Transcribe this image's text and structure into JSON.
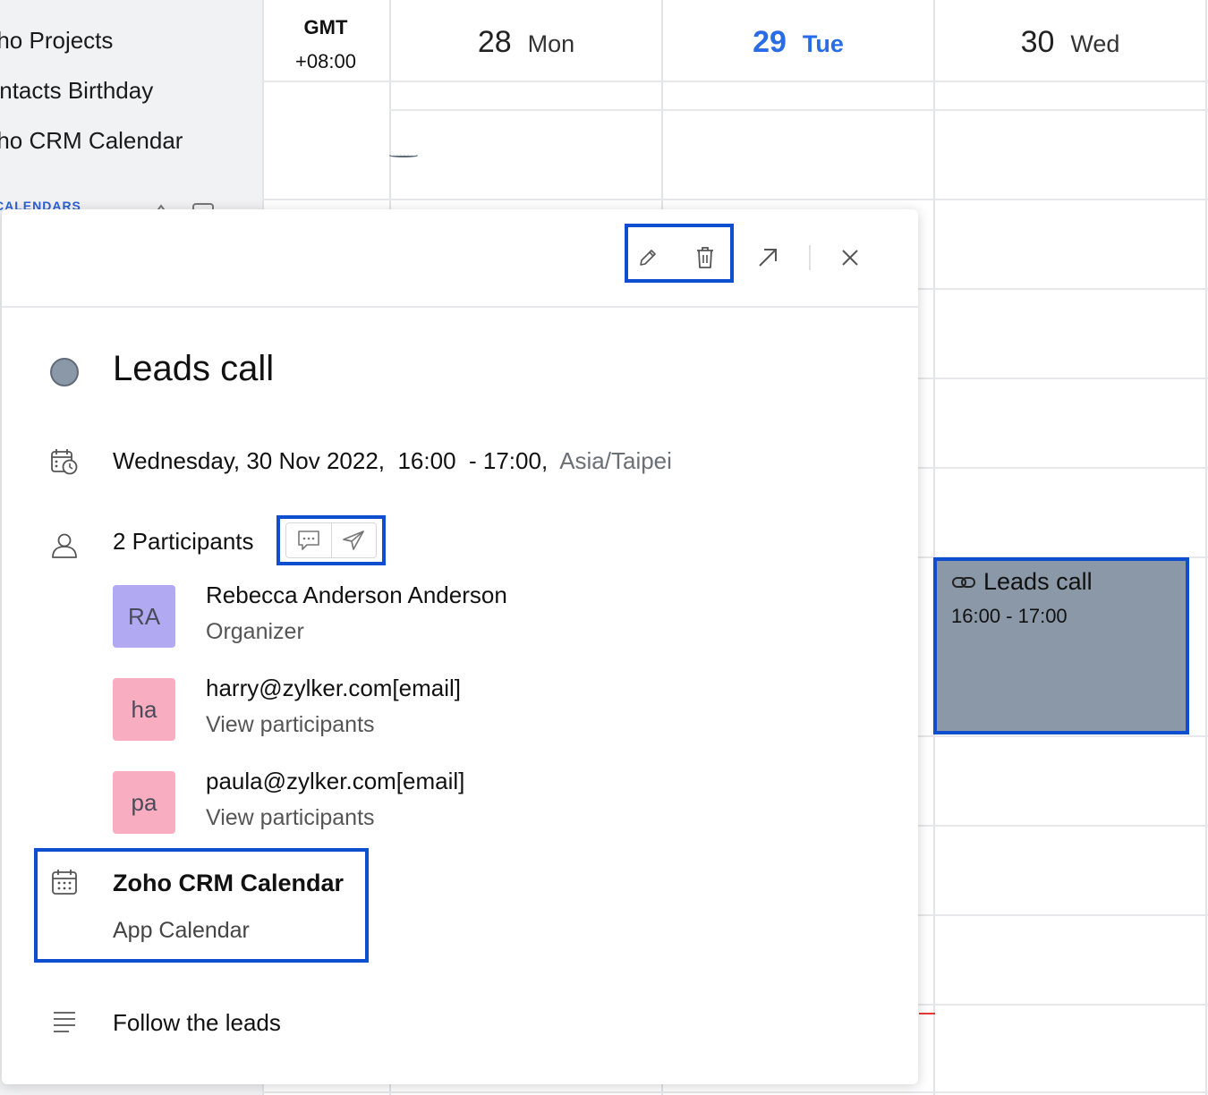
{
  "sidebar": {
    "calendars": [
      "Zoho Projects",
      "Contacts Birthday",
      "Zoho CRM Calendar"
    ],
    "section_heading": "CALENDARS"
  },
  "grid": {
    "timezone_line1": "GMT",
    "timezone_line2": "+08:00",
    "days": [
      {
        "num": "28",
        "name": "Mon",
        "today": false
      },
      {
        "num": "29",
        "name": "Tue",
        "today": true
      },
      {
        "num": "30",
        "name": "Wed",
        "today": false
      }
    ],
    "event": {
      "title": "Leads call",
      "time": "16:00 - 17:00",
      "color": "#8a98a7"
    }
  },
  "popup": {
    "toolbar": {
      "edit_icon": "pencil-icon",
      "delete_icon": "trash-icon",
      "open_icon": "arrow-up-right-icon",
      "close_icon": "close-icon"
    },
    "title": "Leads call",
    "date": "Wednesday, 30 Nov 2022,",
    "start": "16:00",
    "end": "- 17:00,",
    "timezone": "Asia/Taipei",
    "participants_label": "2 Participants",
    "participants": [
      {
        "initials": "RA",
        "name": "Rebecca Anderson Anderson",
        "role": "Organizer",
        "color": "#b1aaf2"
      },
      {
        "initials": "ha",
        "name": "harry@zylker.com[email]",
        "role": "View participants",
        "color": "#f9adc0"
      },
      {
        "initials": "pa",
        "name": "paula@zylker.com[email]",
        "role": "View participants",
        "color": "#f9adc0"
      }
    ],
    "calendar_name": "Zoho CRM Calendar",
    "calendar_type": "App Calendar",
    "description": "Follow the leads",
    "highlight_color": "#0e4fcf"
  }
}
